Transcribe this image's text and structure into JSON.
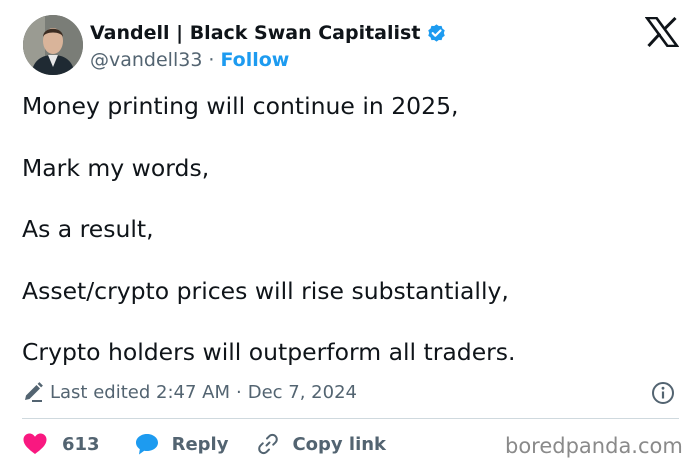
{
  "author": {
    "display_name": "Vandell | Black Swan Capitalist",
    "handle": "@vandell33",
    "separator": "·",
    "follow_label": "Follow",
    "verified_color": "#1d9bf0"
  },
  "tweet": {
    "lines": [
      "Money printing will continue in 2025,",
      "Mark my words,",
      "As a result,",
      "Asset/crypto prices will rise substantially,",
      "Crypto holders will outperform all traders."
    ],
    "edited_label": "Last edited 2:47 AM",
    "separator": "·",
    "date": "Dec 7, 2024"
  },
  "actions": {
    "like_count": "613",
    "reply_label": "Reply",
    "copy_link_label": "Copy link",
    "like_color": "#f91880",
    "reply_color": "#1d9bf0"
  },
  "icons": {
    "platform": "x-logo-icon",
    "verified": "verified-badge-icon",
    "edit": "pencil-icon",
    "info": "info-icon",
    "like": "heart-icon",
    "reply": "speech-bubble-icon",
    "copy": "link-icon"
  },
  "watermark": {
    "text": "boredpanda.com"
  }
}
